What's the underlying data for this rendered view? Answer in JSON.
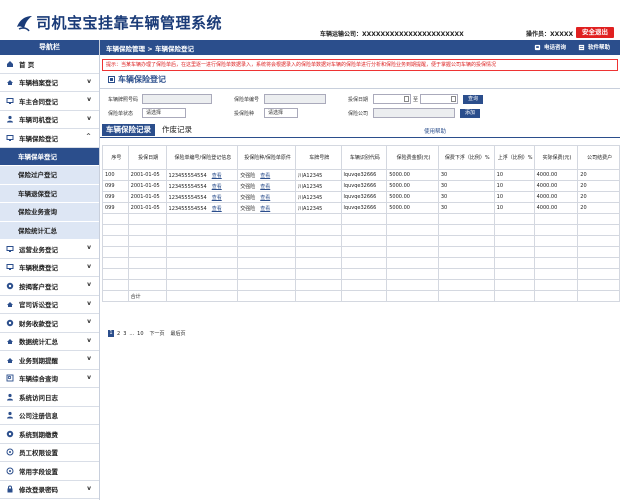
{
  "header": {
    "app_title": "司机宝宝挂靠车辆管理系统",
    "company_label": "车辆运输公司：XXXXXXXXXXXXXXXXXXXXXX",
    "operator_label": "操作员：XXXXX",
    "logout_label": "安全退出"
  },
  "sidebar": {
    "title": "导航栏",
    "items": [
      {
        "label": "首 页",
        "icon": "home-icon",
        "chevron": ""
      },
      {
        "label": "车辆档案登记",
        "icon": "truck-icon",
        "chevron": "v"
      },
      {
        "label": "车主合同登记",
        "icon": "monitor-icon",
        "chevron": "v"
      },
      {
        "label": "车辆司机登记",
        "icon": "user-icon",
        "chevron": "v"
      },
      {
        "label": "车辆保险登记",
        "icon": "monitor-icon",
        "chevron": "^"
      }
    ],
    "subitems": [
      {
        "label": "车辆保单登记",
        "active": true
      },
      {
        "label": "保险过户登记",
        "active": false
      },
      {
        "label": "车辆退保登记",
        "active": false
      },
      {
        "label": "保险业务查询",
        "active": false
      },
      {
        "label": "保险统计汇总",
        "active": false
      }
    ],
    "items2": [
      {
        "label": "运营业务登记",
        "icon": "monitor-icon",
        "chevron": "v"
      },
      {
        "label": "车辆税费登记",
        "icon": "monitor-icon",
        "chevron": "v"
      },
      {
        "label": "按揭客户登记",
        "icon": "gear-icon",
        "chevron": "v"
      },
      {
        "label": "官司诉讼登记",
        "icon": "truck-icon",
        "chevron": "v"
      },
      {
        "label": "财务收款登记",
        "icon": "gear-icon",
        "chevron": "v"
      },
      {
        "label": "数据统计汇总",
        "icon": "truck-icon",
        "chevron": "v"
      },
      {
        "label": "业务到期提醒",
        "icon": "truck-icon",
        "chevron": "v"
      },
      {
        "label": "车辆综合查询",
        "icon": "search-doc-icon",
        "chevron": "v"
      },
      {
        "label": "系统访问日志",
        "icon": "user-icon",
        "chevron": ""
      },
      {
        "label": "公司注册信息",
        "icon": "user-icon",
        "chevron": ""
      },
      {
        "label": "系统到期缴费",
        "icon": "gear-icon",
        "chevron": ""
      },
      {
        "label": "员工权限设置",
        "icon": "gear-outline-icon",
        "chevron": ""
      },
      {
        "label": "常用字段设置",
        "icon": "gear-outline-icon",
        "chevron": ""
      },
      {
        "label": "修改登录密码",
        "icon": "lock-icon",
        "chevron": "v"
      }
    ]
  },
  "main": {
    "breadcrumb": "车辆保险管理 > 车辆保险登记",
    "contact_label": "电话咨询",
    "help_label": "软件帮助",
    "notice": "提示：当某车辆办理了保险单后，在这里逐一进行保险单数据录入，系统将会根据录入的保险单数据对车辆的保险单进行分析和保险业务到期提醒，便于掌握公司车辆的投保情况",
    "section_title": "车辆保险登记",
    "form": {
      "plate_label": "车辆牌照号码",
      "policy_label": "保险单编号",
      "date_label": "投保日期",
      "to_label": "至",
      "query_label": "查询",
      "status_label": "保险单状态",
      "status_value": "请选择",
      "type_label": "投保险种",
      "type_value": "请选择",
      "company_label": "保险公司",
      "add_label": "添加"
    },
    "tabs": {
      "active": "车辆保险记录",
      "other": "作废记录",
      "help": "使用帮助"
    },
    "table": {
      "headers": [
        "序号",
        "投保日期",
        "保险单编号/保险登记信息",
        "投保险种/保险单原件",
        "车牌号牌",
        "车辆识别代码",
        "保险费金额(元)",
        "保费下浮（比例）%",
        "上浮（比例）%",
        "实际保费(元)",
        "公司结费户"
      ],
      "rows": [
        [
          "100",
          "2001-01-05",
          "123455554554",
          "查看",
          "交强险",
          "查看",
          "川A12345",
          "lquvqe32666",
          "5000.00",
          "30",
          "10",
          "4000.00",
          "20"
        ],
        [
          "099",
          "2001-01-05",
          "123455554554",
          "查看",
          "交强险",
          "查看",
          "川A12345",
          "lquvqe32666",
          "5000.00",
          "30",
          "10",
          "4000.00",
          "20"
        ],
        [
          "099",
          "2001-01-05",
          "123455554554",
          "查看",
          "交强险",
          "查看",
          "川A12345",
          "lquvqe32666",
          "5000.00",
          "30",
          "10",
          "4000.00",
          "20"
        ],
        [
          "099",
          "2001-01-05",
          "123455554554",
          "查看",
          "交强险",
          "查看",
          "川A12345",
          "lquvqe32666",
          "5000.00",
          "30",
          "10",
          "4000.00",
          "20"
        ]
      ],
      "total_label": "合计"
    },
    "pager": {
      "pages": [
        "1",
        "2",
        "3",
        "...",
        "10"
      ],
      "next": "下一页",
      "last": "最后页"
    }
  },
  "colors": {
    "primary": "#2b4e8c",
    "danger": "#e02020",
    "sub_bg": "#dde6f4"
  }
}
